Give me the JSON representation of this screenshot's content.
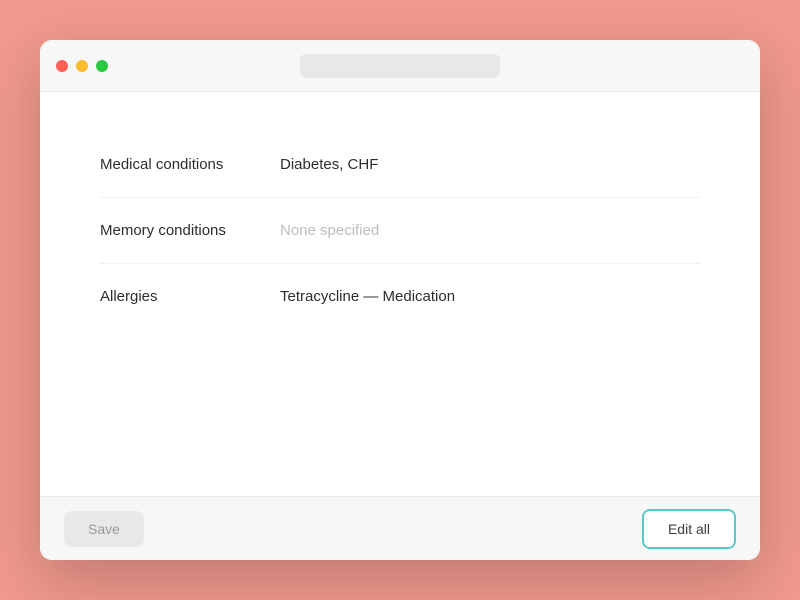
{
  "titlebar": {
    "traffic_close_label": "",
    "traffic_minimize_label": "",
    "traffic_maximize_label": ""
  },
  "fields": [
    {
      "label": "Medical conditions",
      "value": "Diabetes, CHF",
      "empty": false
    },
    {
      "label": "Memory conditions",
      "value": "None specified",
      "empty": true
    },
    {
      "label": "Allergies",
      "value": "Tetracycline — Medication",
      "empty": false
    }
  ],
  "footer": {
    "save_label": "Save",
    "edit_all_label": "Edit all"
  },
  "colors": {
    "background": "#f0998d",
    "accent": "#5ac8c8"
  }
}
